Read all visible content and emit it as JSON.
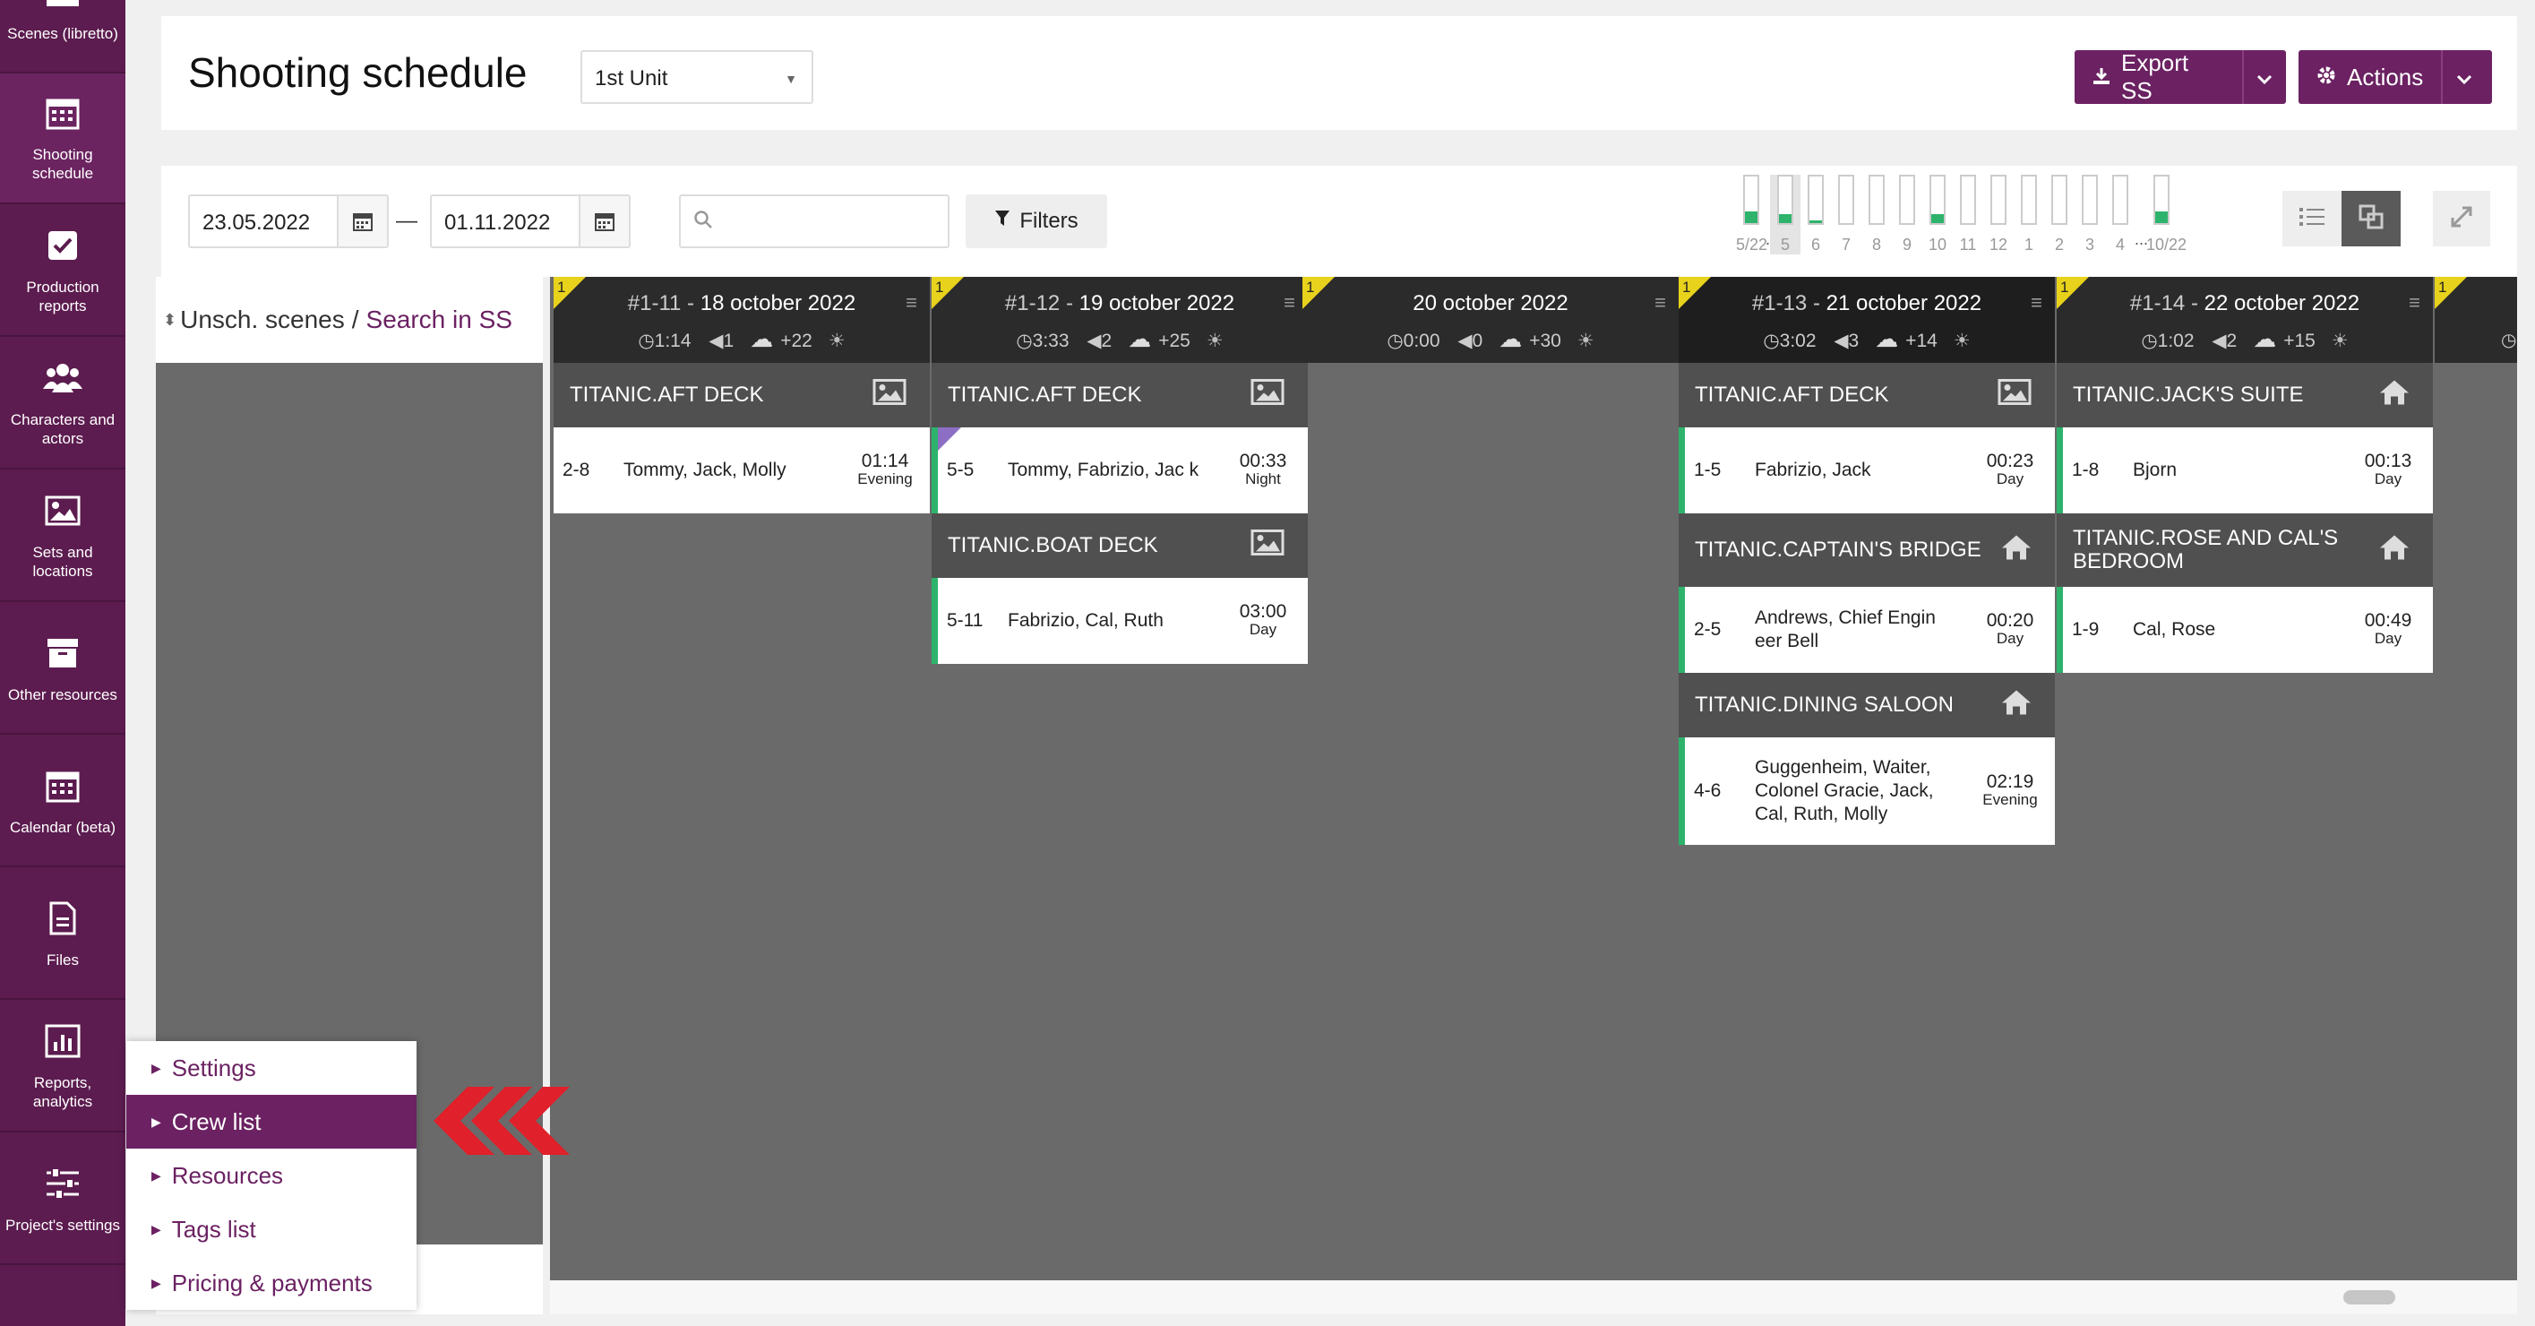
{
  "sidebar": {
    "items": [
      {
        "label": "Scenes (libretto)",
        "icon": "clapperboard-icon"
      },
      {
        "label": "Shooting schedule",
        "icon": "calendar-grid-icon"
      },
      {
        "label": "Production reports",
        "icon": "checkbox-icon"
      },
      {
        "label": "Characters and actors",
        "icon": "users-icon"
      },
      {
        "label": "Sets and locations",
        "icon": "image-icon"
      },
      {
        "label": "Other resources",
        "icon": "archive-icon"
      },
      {
        "label": "Calendar (beta)",
        "icon": "calendar-icon"
      },
      {
        "label": "Files",
        "icon": "file-icon"
      },
      {
        "label": "Reports, analytics",
        "icon": "bar-chart-icon"
      },
      {
        "label": "Project's settings",
        "icon": "sliders-icon"
      }
    ]
  },
  "header": {
    "title": "Shooting schedule",
    "unit": "1st Unit",
    "export_label": "Export SS",
    "actions_label": "Actions"
  },
  "toolbar": {
    "date_from": "23.05.2022",
    "date_to": "01.11.2022",
    "dash": "—",
    "search_placeholder": "",
    "filters_label": "Filters",
    "mini_bars": [
      {
        "label": "5/22",
        "fill": 0.25,
        "dots": "..."
      },
      {
        "label": "5",
        "fill": 0.2,
        "selected": true
      },
      {
        "label": "6",
        "fill": 0.05
      },
      {
        "label": "7",
        "fill": 0
      },
      {
        "label": "8",
        "fill": 0
      },
      {
        "label": "9",
        "fill": 0
      },
      {
        "label": "10",
        "fill": 0.2
      },
      {
        "label": "11",
        "fill": 0
      },
      {
        "label": "12",
        "fill": 0
      },
      {
        "label": "1",
        "fill": 0
      },
      {
        "label": "2",
        "fill": 0
      },
      {
        "label": "3",
        "fill": 0
      },
      {
        "label": "4",
        "fill": 0,
        "dots": "..."
      },
      {
        "label": "10/22",
        "fill": 0.25
      }
    ]
  },
  "unscheduled": {
    "label": "Unsch. scenes",
    "separator": "/",
    "link": "Search in SS"
  },
  "days": [
    {
      "flag": "1",
      "code": "#1-11",
      "sep": " - ",
      "date": "18 october 2022",
      "duration": "1:14",
      "scenes": "1",
      "weather": "+22",
      "sets": [
        {
          "name": "TITANIC.AFT DECK",
          "icon": "image-icon",
          "scenes": [
            {
              "num": "2-8",
              "chars": "Tommy, Jack, Molly",
              "time": "01:14",
              "period": "Evening",
              "green": false
            }
          ]
        }
      ]
    },
    {
      "flag": "1",
      "code": "#1-12",
      "sep": " - ",
      "date": "19 october 2022",
      "duration": "3:33",
      "scenes": "2",
      "weather": "+25",
      "sets": [
        {
          "name": "TITANIC.AFT DECK",
          "icon": "image-icon",
          "scenes": [
            {
              "num": "5-5",
              "chars": "Tommy, Fabrizio, Jac k",
              "time": "00:33",
              "period": "Night",
              "green": true
            }
          ]
        },
        {
          "name": "TITANIC.BOAT DECK",
          "icon": "image-icon",
          "scenes": [
            {
              "num": "5-11",
              "chars": "Fabrizio, Cal, Ruth",
              "time": "03:00",
              "period": "Day",
              "green": true
            }
          ]
        }
      ]
    },
    {
      "flag": "1",
      "code": "",
      "sep": "",
      "date": "20 october 2022",
      "duration": "0:00",
      "scenes": "0",
      "weather": "+30",
      "sets": []
    },
    {
      "flag": "1",
      "code": "#1-13",
      "sep": " - ",
      "date": "21 october 2022",
      "duration": "3:02",
      "scenes": "3",
      "weather": "+14",
      "sets": [
        {
          "name": "TITANIC.AFT DECK",
          "icon": "image-icon",
          "scenes": [
            {
              "num": "1-5",
              "chars": "Fabrizio, Jack",
              "time": "00:23",
              "period": "Day",
              "green": true
            }
          ]
        },
        {
          "name": "TITANIC.CAPTAIN'S BRIDGE",
          "icon": "house-icon",
          "scenes": [
            {
              "num": "2-5",
              "chars": "Andrews, Chief Engin eer Bell",
              "time": "00:20",
              "period": "Day",
              "green": true
            }
          ]
        },
        {
          "name": "TITANIC.DINING SALOON",
          "icon": "house-icon",
          "scenes": [
            {
              "num": "4-6",
              "chars": "Guggenheim, Waiter, Colonel Gracie, Jack, Cal, Ruth, Molly",
              "time": "02:19",
              "period": "Evening",
              "green": true
            }
          ]
        }
      ]
    },
    {
      "flag": "1",
      "code": "#1-14",
      "sep": " - ",
      "date": "22 october 2022",
      "duration": "1:02",
      "scenes": "2",
      "weather": "+15",
      "sets": [
        {
          "name": "TITANIC.JACK'S SUITE",
          "icon": "house-icon",
          "scenes": [
            {
              "num": "1-8",
              "chars": "Bjorn",
              "time": "00:13",
              "period": "Day",
              "green": true
            }
          ]
        },
        {
          "name": "TITANIC.ROSE AND CAL'S BEDROOM",
          "icon": "house-icon",
          "scenes": [
            {
              "num": "1-9",
              "chars": "Cal, Rose",
              "time": "00:49",
              "period": "Day",
              "green": true
            }
          ]
        }
      ]
    }
  ],
  "next_day_flag": "1",
  "settings_menu": {
    "items": [
      {
        "label": "Settings",
        "active": false
      },
      {
        "label": "Crew list",
        "active": true
      },
      {
        "label": "Resources",
        "active": false
      },
      {
        "label": "Tags list",
        "active": false
      },
      {
        "label": "Pricing & payments",
        "active": false
      }
    ]
  },
  "colors": {
    "brand": "#6b2162",
    "sidebar": "#5c1c4f",
    "accent_green": "#2db36b",
    "flag_yellow": "#e8d21c",
    "pointer_red": "#e0202a"
  }
}
